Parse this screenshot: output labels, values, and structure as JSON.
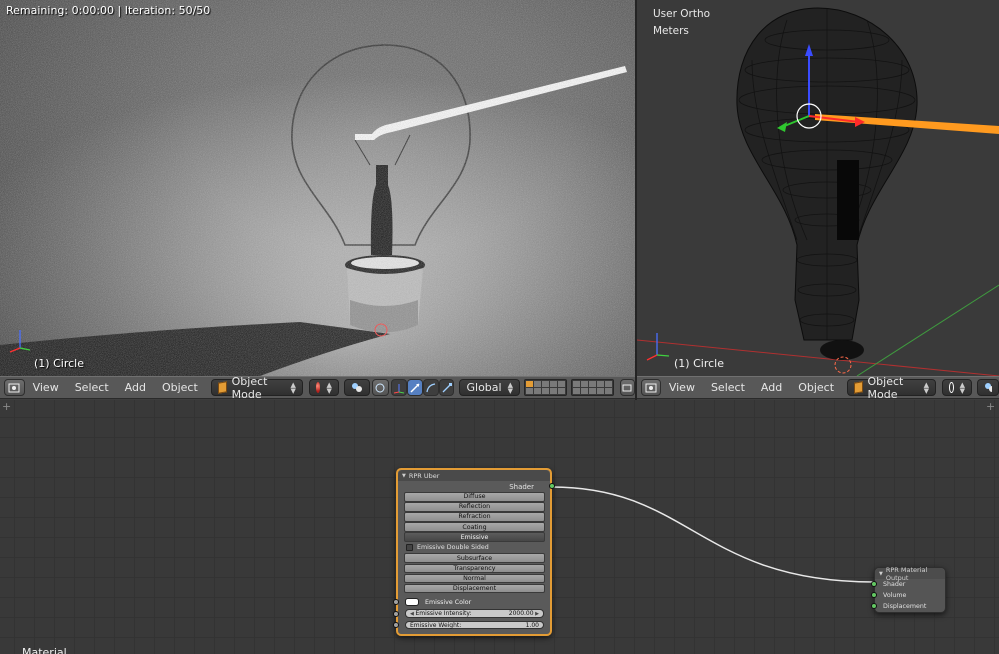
{
  "render_view": {
    "status": "Remaining: 0:00:00 | Iteration: 50/50",
    "object_label": "(1) Circle"
  },
  "wire_view": {
    "view_label": "User Ortho",
    "units_label": "Meters",
    "object_label": "(1) Circle"
  },
  "header_left": {
    "menus": [
      "View",
      "Select",
      "Add",
      "Object"
    ],
    "mode": "Object Mode",
    "orientation": "Global"
  },
  "header_right": {
    "menus": [
      "View",
      "Select",
      "Add",
      "Object"
    ],
    "mode": "Object Mode"
  },
  "node_editor": {
    "material_label": "Material",
    "rpr_uber": {
      "title": "RPR Uber",
      "output": "Shader",
      "buttons": [
        "Diffuse",
        "Reflection",
        "Refraction",
        "Coating",
        "Emissive"
      ],
      "active_button": "Emissive",
      "double_sided_label": "Emissive Double Sided",
      "buttons2": [
        "Subsurface",
        "Transparency",
        "Normal",
        "Displacement"
      ],
      "emissive_color_label": "Emissive Color",
      "emissive_color": "#ffffff",
      "intensity_label": "Emissive Intensity:",
      "intensity_value": "2000.00",
      "weight_label": "Emissive Weight:",
      "weight_value": "1.00"
    },
    "material_output": {
      "title": "RPR Material Output",
      "inputs": [
        "Shader",
        "Volume",
        "Displacement"
      ]
    }
  },
  "colors": {
    "accent": "#e39c35",
    "socket_green": "#63c763",
    "header_bg": "#585858",
    "node_editor_bg": "#393939"
  }
}
